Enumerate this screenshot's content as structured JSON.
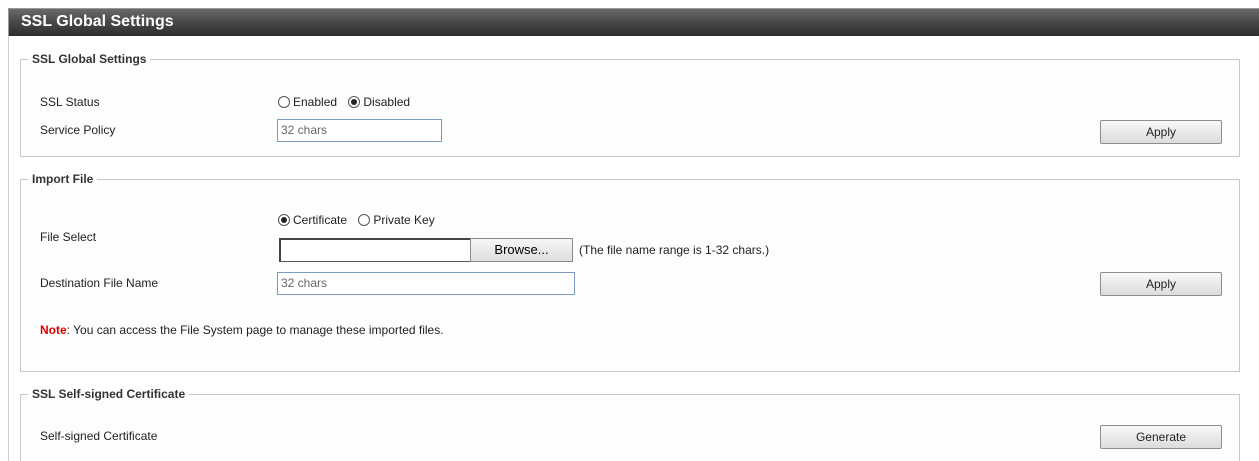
{
  "page": {
    "title": "SSL Global Settings"
  },
  "ssl_global": {
    "legend": "SSL Global Settings",
    "status_label": "SSL Status",
    "status_options": {
      "enabled": "Enabled",
      "disabled": "Disabled"
    },
    "status_selected": "Disabled",
    "policy_label": "Service Policy",
    "policy_placeholder": "32 chars",
    "apply_label": "Apply"
  },
  "import_file": {
    "legend": "Import File",
    "file_select_label": "File Select",
    "options": {
      "certificate": "Certificate",
      "private_key": "Private Key"
    },
    "selected": "Certificate",
    "browse_label": "Browse...",
    "hint": "(The file name range is 1-32 chars.)",
    "dest_label": "Destination File Name",
    "dest_placeholder": "32 chars",
    "apply_label": "Apply",
    "note_key": "Note",
    "note_text": ": You can access the File System page to manage these imported files."
  },
  "self_signed": {
    "legend": "SSL Self-signed Certificate",
    "label": "Self-signed Certificate",
    "generate_label": "Generate"
  }
}
